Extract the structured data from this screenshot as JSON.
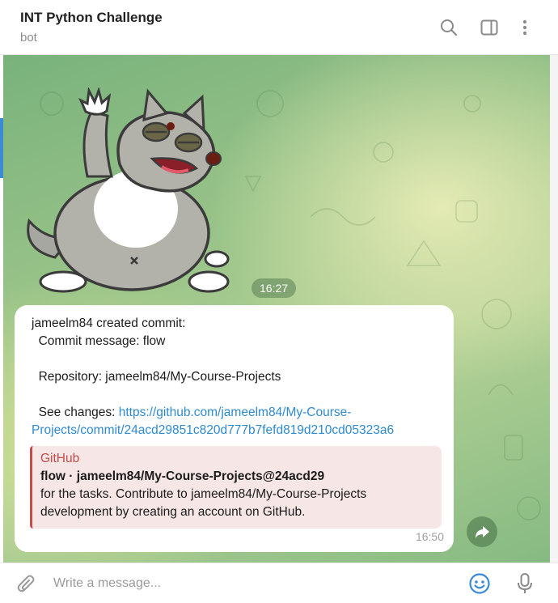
{
  "header": {
    "title": "INT Python Challenge",
    "subtitle": "bot",
    "icons": [
      "search-icon",
      "sidebar-toggle-icon",
      "more-vertical-icon"
    ]
  },
  "sticker": {
    "time": "16:27"
  },
  "message": {
    "line1": "jameelm84 created commit:",
    "line2": "  Commit message: flow",
    "line3": "  Repository: jameelm84/My-Course-Projects",
    "line4_prefix": "  See changes: ",
    "link_part1": "https://github.com/jameelm84/My-Course-",
    "link_part2": "Projects/commit/24acd29851c820d777b7fefd819d210cd05323a6",
    "preview": {
      "site": "GitHub",
      "title": "flow · jameelm84/My-Course-Projects@24acd29",
      "description1": "for the tasks. Contribute to jameelm84/My-Course-Projects",
      "description2": "development by creating an account on GitHub."
    },
    "time": "16:50"
  },
  "composer": {
    "placeholder": "Write a message..."
  },
  "colors": {
    "accent": "#3a8ad4",
    "link": "#2f8ad0",
    "preview_accent": "#c84a4a",
    "preview_bg": "#f7e6e6"
  }
}
